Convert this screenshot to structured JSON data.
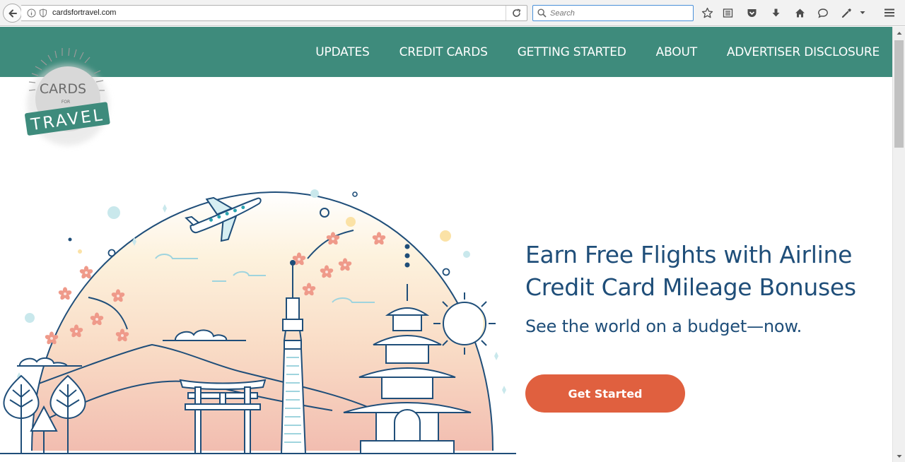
{
  "browser": {
    "url": "cardsfortravel.com",
    "search_placeholder": "Search"
  },
  "site": {
    "logo": {
      "top": "CARDS",
      "middle": "FOR",
      "bottom": "TRAVEL"
    },
    "nav": [
      {
        "label": "UPDATES"
      },
      {
        "label": "CREDIT CARDS"
      },
      {
        "label": "GETTING STARTED"
      },
      {
        "label": "ABOUT"
      },
      {
        "label": "ADVERTISER DISCLOSURE"
      }
    ],
    "hero": {
      "title_line1": "Earn Free Flights with Airline",
      "title_line2": "Credit Card Mileage Bonuses",
      "subtitle": "See the world on a budget—now.",
      "cta_label": "Get Started"
    }
  },
  "colors": {
    "brand_teal": "#3e8b7c",
    "headline_navy": "#1f4e79",
    "cta_orange": "#e0603f"
  },
  "icons": [
    "back-arrow-icon",
    "info-icon",
    "shield-icon",
    "reload-icon",
    "search-icon",
    "star-icon",
    "reading-list-icon",
    "pocket-icon",
    "download-icon",
    "home-icon",
    "chat-icon",
    "tools-icon",
    "dropdown-icon",
    "menu-icon"
  ]
}
